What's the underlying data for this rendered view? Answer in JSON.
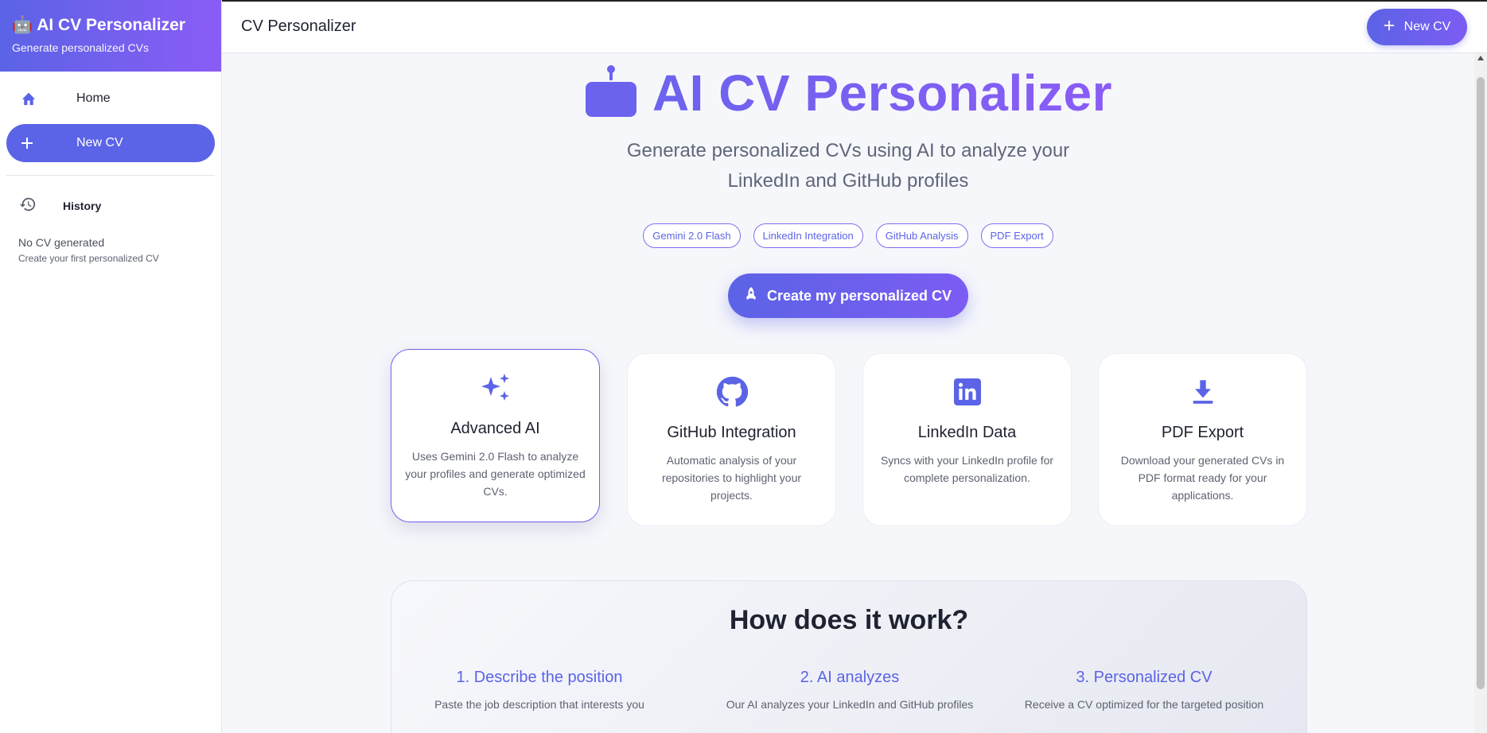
{
  "sidebar": {
    "brand_title": "🤖 AI CV Personalizer",
    "brand_subtitle": "Generate personalized CVs",
    "nav": [
      {
        "label": "Home",
        "icon": "home-icon"
      },
      {
        "label": "New CV",
        "icon": "plus-icon",
        "active": true
      }
    ],
    "history_label": "History",
    "empty_title": "No CV generated",
    "empty_subtitle": "Create your first personalized CV"
  },
  "topbar": {
    "title": "CV Personalizer",
    "new_button": "New CV"
  },
  "hero": {
    "title": "AI CV Personalizer",
    "subtitle_line1": "Generate personalized CVs using AI to analyze your",
    "subtitle_line2": "LinkedIn and GitHub profiles",
    "chips": [
      "Gemini 2.0 Flash",
      "LinkedIn Integration",
      "GitHub Analysis",
      "PDF Export"
    ],
    "cta": "Create my personalized CV"
  },
  "features": [
    {
      "title": "Advanced AI",
      "desc": "Uses Gemini 2.0 Flash to analyze your profiles and generate optimized CVs.",
      "icon": "sparkles-icon"
    },
    {
      "title": "GitHub Integration",
      "desc": "Automatic analysis of your repositories to highlight your projects.",
      "icon": "github-icon"
    },
    {
      "title": "LinkedIn Data",
      "desc": "Syncs with your LinkedIn profile for complete personalization.",
      "icon": "linkedin-icon"
    },
    {
      "title": "PDF Export",
      "desc": "Download your generated CVs in PDF format ready for your applications.",
      "icon": "download-icon"
    }
  ],
  "how": {
    "title": "How does it work?",
    "steps": [
      {
        "title": "1. Describe the position",
        "desc": "Paste the job description that interests you"
      },
      {
        "title": "2. AI analyzes",
        "desc": "Our AI analyzes your LinkedIn and GitHub profiles"
      },
      {
        "title": "3. Personalized CV",
        "desc": "Receive a CV optimized for the targeted position"
      }
    ]
  },
  "colors": {
    "accent": "#5b63e6",
    "accent2": "#8b5cf6"
  }
}
